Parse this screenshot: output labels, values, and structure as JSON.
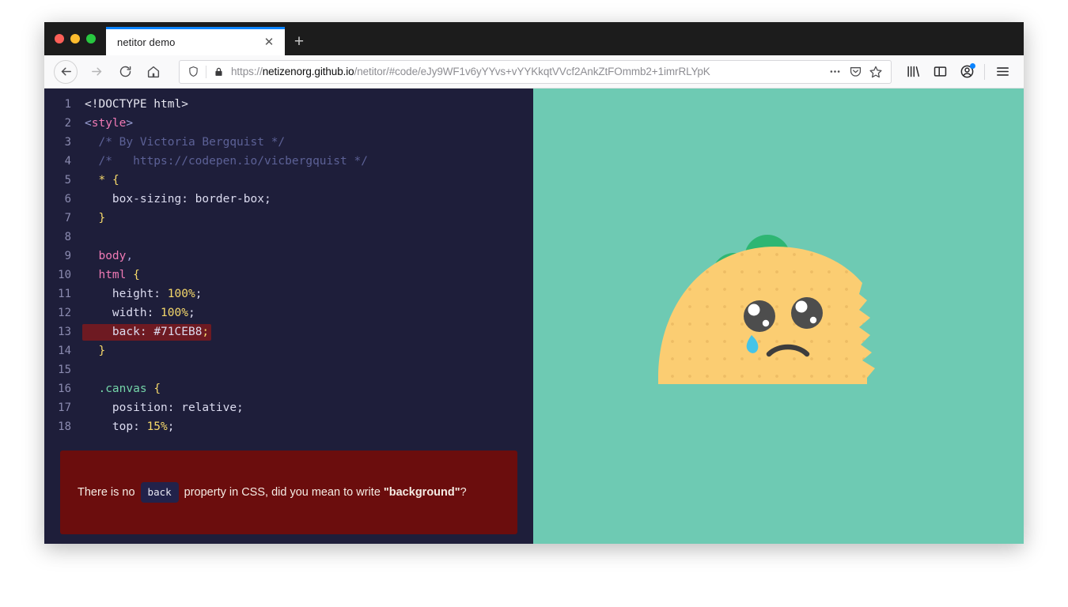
{
  "window": {
    "traffic_lights": [
      "close",
      "minimize",
      "maximize"
    ]
  },
  "tabs": {
    "active_title": "netitor demo",
    "close_glyph": "✕",
    "new_tab_glyph": "+"
  },
  "navbar": {
    "back_label": "←",
    "forward_label": "→",
    "reload_label": "⟳",
    "home_label": "⌂",
    "more_label": "•••",
    "pocket_label": "pocket",
    "bookmark_label": "☆",
    "library_label": "library",
    "sidebar_label": "sidebar",
    "account_label": "account",
    "menu_label": "☰"
  },
  "url": {
    "scheme": "https://",
    "host": "netizenorg.github.io",
    "path": "/netitor/#code/eJy9WF1v6yYYvs+vYYKkqtVVcf2AnkZtFOmmb2+1imrRLYpK",
    "full": "https://netizenorg.github.io/netitor/#code/eJy9WF1v6yYYvs+vYYKkqtVVcf2AnkZtFOmmb2+1imrRLYp"
  },
  "editor": {
    "lines": [
      {
        "n": "1",
        "tokens": [
          {
            "t": "<!DOCTYPE html>",
            "c": "t-plain"
          }
        ]
      },
      {
        "n": "2",
        "tokens": [
          {
            "t": "<",
            "c": "t-punct"
          },
          {
            "t": "style",
            "c": "t-tag"
          },
          {
            "t": ">",
            "c": "t-punct"
          }
        ]
      },
      {
        "n": "3",
        "tokens": [
          {
            "t": "  /* By Victoria Bergquist */",
            "c": "t-comment"
          }
        ]
      },
      {
        "n": "4",
        "tokens": [
          {
            "t": "  /*   https://codepen.io/vicbergquist */",
            "c": "t-comment"
          }
        ]
      },
      {
        "n": "5",
        "tokens": [
          {
            "t": "  ",
            "c": "t-plain"
          },
          {
            "t": "*",
            "c": "t-star"
          },
          {
            "t": " ",
            "c": "t-plain"
          },
          {
            "t": "{",
            "c": "t-brace"
          }
        ]
      },
      {
        "n": "6",
        "tokens": [
          {
            "t": "    box-sizing: border-box;",
            "c": "t-prop"
          }
        ]
      },
      {
        "n": "7",
        "tokens": [
          {
            "t": "  ",
            "c": "t-plain"
          },
          {
            "t": "}",
            "c": "t-brace"
          }
        ]
      },
      {
        "n": "8",
        "tokens": [
          {
            "t": "",
            "c": "t-plain"
          }
        ]
      },
      {
        "n": "9",
        "tokens": [
          {
            "t": "  ",
            "c": "t-plain"
          },
          {
            "t": "body",
            "c": "t-sel"
          },
          {
            "t": ",",
            "c": "t-punct"
          }
        ]
      },
      {
        "n": "10",
        "tokens": [
          {
            "t": "  ",
            "c": "t-plain"
          },
          {
            "t": "html",
            "c": "t-sel"
          },
          {
            "t": " ",
            "c": "t-plain"
          },
          {
            "t": "{",
            "c": "t-brace"
          }
        ]
      },
      {
        "n": "11",
        "tokens": [
          {
            "t": "    height: ",
            "c": "t-prop"
          },
          {
            "t": "100%",
            "c": "t-num"
          },
          {
            "t": ";",
            "c": "t-prop"
          }
        ]
      },
      {
        "n": "12",
        "tokens": [
          {
            "t": "    width: ",
            "c": "t-prop"
          },
          {
            "t": "100%",
            "c": "t-num"
          },
          {
            "t": ";",
            "c": "t-prop"
          }
        ]
      },
      {
        "n": "13",
        "error": true,
        "tokens": [
          {
            "t": "    back: ",
            "c": "t-prop"
          },
          {
            "t": "#71CEB8",
            "c": "t-prop"
          },
          {
            "t": ";",
            "c": "t-num"
          }
        ]
      },
      {
        "n": "14",
        "tokens": [
          {
            "t": "  ",
            "c": "t-plain"
          },
          {
            "t": "}",
            "c": "t-brace"
          }
        ]
      },
      {
        "n": "15",
        "tokens": [
          {
            "t": "",
            "c": "t-plain"
          }
        ]
      },
      {
        "n": "16",
        "tokens": [
          {
            "t": "  ",
            "c": "t-plain"
          },
          {
            "t": ".canvas",
            "c": "t-class"
          },
          {
            "t": " ",
            "c": "t-plain"
          },
          {
            "t": "{",
            "c": "t-brace"
          }
        ]
      },
      {
        "n": "17",
        "tokens": [
          {
            "t": "    position: relative;",
            "c": "t-prop"
          }
        ]
      },
      {
        "n": "18",
        "tokens": [
          {
            "t": "    top: ",
            "c": "t-prop"
          },
          {
            "t": "15%",
            "c": "t-num"
          },
          {
            "t": ";",
            "c": "t-prop"
          }
        ]
      }
    ]
  },
  "error": {
    "prefix": "There is no",
    "chip": "back",
    "middle": "property in CSS, did you mean to write",
    "suggestion": "\"background\"",
    "suffix": "?"
  },
  "preview": {
    "background_color": "#6ecab3",
    "illustration": "sad-crying-taco",
    "shell_color": "#fbcd72",
    "lettuce_color": "#2eb673",
    "tomato_color": "#d35b55",
    "meat_color": "#7b4a2e",
    "eye_color": "#4d4d4d",
    "tear_color": "#45c4e8"
  },
  "colors": {
    "editor_bg": "#1e1e3a",
    "error_panel_bg": "#6b0d0d",
    "error_highlight": "#6e1a22",
    "tab_accent": "#0a84ff"
  }
}
